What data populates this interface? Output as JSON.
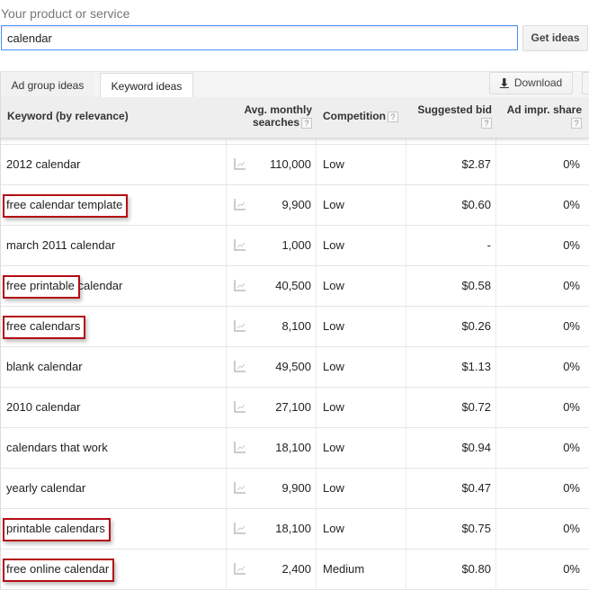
{
  "search": {
    "label": "Your product or service",
    "value": "calendar",
    "button": "Get ideas"
  },
  "tabs": [
    {
      "label": "Ad group ideas",
      "active": false
    },
    {
      "label": "Keyword ideas",
      "active": true
    }
  ],
  "toolbar": {
    "download_label": "Download",
    "download_icon": "download-arrow-icon"
  },
  "table": {
    "headers": {
      "keyword": "Keyword (by relevance)",
      "avg_line1": "Avg. monthly",
      "avg_line2": "searches",
      "competition": "Competition",
      "bid": "Suggested bid",
      "share": "Ad impr. share",
      "help": "?"
    },
    "trend_icon": "trend-chart-icon",
    "highlight_color": "#b30d14",
    "rows": [
      {
        "keyword": "2012 calendar",
        "avg": "110,000",
        "competition": "Low",
        "bid": "$2.87",
        "share": "0%",
        "highlighted": false
      },
      {
        "keyword": "free calendar template",
        "avg": "9,900",
        "competition": "Low",
        "bid": "$0.60",
        "share": "0%",
        "highlighted": true
      },
      {
        "keyword": "march 2011 calendar",
        "avg": "1,000",
        "competition": "Low",
        "bid": "-",
        "share": "0%",
        "highlighted": false
      },
      {
        "keyword": "free printable calendar",
        "avg": "40,500",
        "competition": "Low",
        "bid": "$0.58",
        "share": "0%",
        "highlighted": true,
        "highlight_text": "free printable"
      },
      {
        "keyword": "free calendars",
        "avg": "8,100",
        "competition": "Low",
        "bid": "$0.26",
        "share": "0%",
        "highlighted": true
      },
      {
        "keyword": "blank calendar",
        "avg": "49,500",
        "competition": "Low",
        "bid": "$1.13",
        "share": "0%",
        "highlighted": false
      },
      {
        "keyword": "2010 calendar",
        "avg": "27,100",
        "competition": "Low",
        "bid": "$0.72",
        "share": "0%",
        "highlighted": false
      },
      {
        "keyword": "calendars that work",
        "avg": "18,100",
        "competition": "Low",
        "bid": "$0.94",
        "share": "0%",
        "highlighted": false
      },
      {
        "keyword": "yearly calendar",
        "avg": "9,900",
        "competition": "Low",
        "bid": "$0.47",
        "share": "0%",
        "highlighted": false
      },
      {
        "keyword": "printable calendars",
        "avg": "18,100",
        "competition": "Low",
        "bid": "$0.75",
        "share": "0%",
        "highlighted": true
      },
      {
        "keyword": "free online calendar",
        "avg": "2,400",
        "competition": "Medium",
        "bid": "$0.80",
        "share": "0%",
        "highlighted": true
      }
    ]
  }
}
